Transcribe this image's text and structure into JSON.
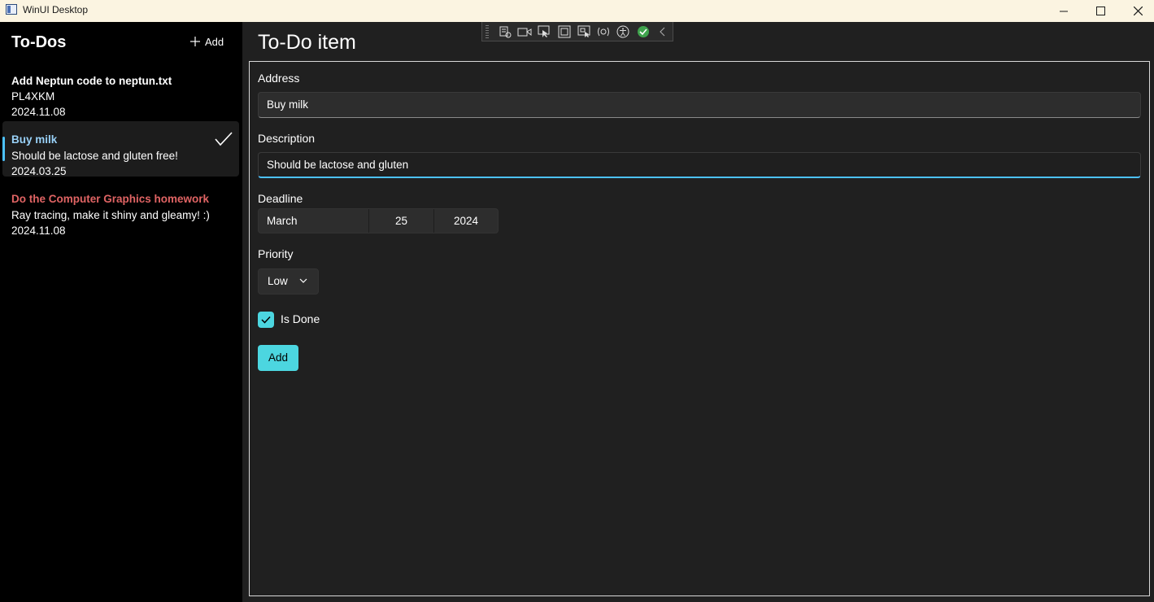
{
  "window": {
    "title": "WinUI Desktop"
  },
  "sidebar": {
    "title": "To-Dos",
    "add_label": "Add",
    "items": [
      {
        "title": "Add Neptun code to neptun.txt",
        "description": "PL4XKM",
        "date": "2024.11.08",
        "title_color": "#ffffff",
        "done": false,
        "selected": false
      },
      {
        "title": "Buy milk",
        "description": "Should be lactose and gluten free!",
        "date": "2024.03.25",
        "title_color": "#99d1f7",
        "done": true,
        "selected": true
      },
      {
        "title": "Do the Computer Graphics homework",
        "description": "Ray tracing, make it shiny and gleamy! :)",
        "date": "2024.11.08",
        "title_color": "#e06464",
        "done": false,
        "selected": false
      }
    ]
  },
  "main": {
    "title": "To-Do item",
    "address_label": "Address",
    "address_value": "Buy milk",
    "description_label": "Description",
    "description_value": "Should be lactose and gluten",
    "deadline_label": "Deadline",
    "deadline": {
      "month": "March",
      "day": "25",
      "year": "2024"
    },
    "priority_label": "Priority",
    "priority_value": "Low",
    "is_done_label": "Is Done",
    "is_done": true,
    "submit_label": "Add"
  },
  "debug_toolbar": {
    "icons": [
      "live-visual-tree-icon",
      "record-icon",
      "select-element-icon",
      "display-layout-icon",
      "track-focus-icon",
      "binding-failures-icon",
      "accessibility-icon",
      "hot-reload-ok-icon",
      "collapse-icon"
    ]
  },
  "colors": {
    "accent": "#4cd6e0",
    "focus": "#4cc2ff",
    "sidebar_bg": "#000000",
    "main_bg": "#202020"
  }
}
